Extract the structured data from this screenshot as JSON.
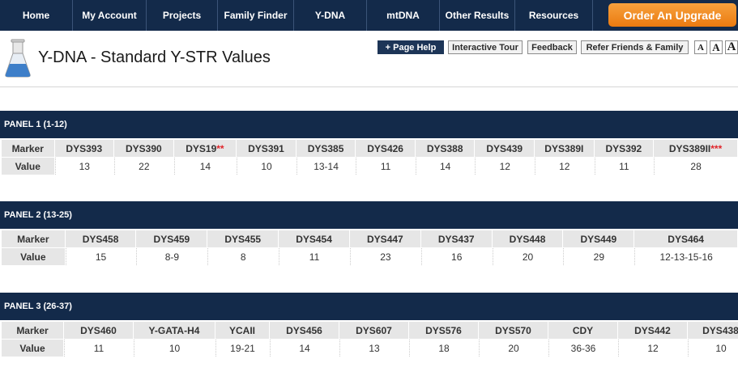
{
  "nav": {
    "items": [
      "Home",
      "My Account",
      "Projects",
      "Family Finder",
      "Y-DNA",
      "mtDNA",
      "Other Results",
      "Resources"
    ],
    "upgrade_label": "Order An Upgrade"
  },
  "header": {
    "title": "Y-DNA - Standard Y-STR Values",
    "page_help": "+ Page Help",
    "interactive_tour": "Interactive Tour",
    "feedback": "Feedback",
    "refer": "Refer Friends & Family",
    "font_sizes": [
      "A",
      "A",
      "A"
    ]
  },
  "colors": {
    "nav_bg": "#132a4a",
    "accent_orange": "#f08a24",
    "panel_bg": "#132a4a",
    "footnote_red": "#e0242a"
  },
  "icons": {
    "logo": "flask-icon"
  },
  "row_labels": {
    "marker": "Marker",
    "value": "Value"
  },
  "panels": [
    {
      "title": "PANEL 1 (1-12)",
      "markers": [
        "DYS393",
        "DYS390",
        "DYS19",
        "DYS391",
        "DYS385",
        "DYS426",
        "DYS388",
        "DYS439",
        "DYS389I",
        "DYS392",
        "DYS389II"
      ],
      "marker_notes": [
        "",
        "",
        "**",
        "",
        "",
        "",
        "",
        "",
        "",
        "",
        "***"
      ],
      "values": [
        "13",
        "22",
        "14",
        "10",
        "13-14",
        "11",
        "14",
        "12",
        "12",
        "11",
        "28"
      ]
    },
    {
      "title": "PANEL 2 (13-25)",
      "markers": [
        "DYS458",
        "DYS459",
        "DYS455",
        "DYS454",
        "DYS447",
        "DYS437",
        "DYS448",
        "DYS449",
        "DYS464"
      ],
      "marker_notes": [
        "",
        "",
        "",
        "",
        "",
        "",
        "",
        "",
        ""
      ],
      "values": [
        "15",
        "8-9",
        "8",
        "11",
        "23",
        "16",
        "20",
        "29",
        "12-13-15-16"
      ]
    },
    {
      "title": "PANEL 3 (26-37)",
      "markers": [
        "DYS460",
        "Y-GATA-H4",
        "YCAII",
        "DYS456",
        "DYS607",
        "DYS576",
        "DYS570",
        "CDY",
        "DYS442",
        "DYS438"
      ],
      "marker_notes": [
        "",
        "",
        "",
        "",
        "",
        "",
        "",
        "",
        "",
        ""
      ],
      "values": [
        "11",
        "10",
        "19-21",
        "14",
        "13",
        "18",
        "20",
        "36-36",
        "12",
        "10"
      ]
    }
  ]
}
